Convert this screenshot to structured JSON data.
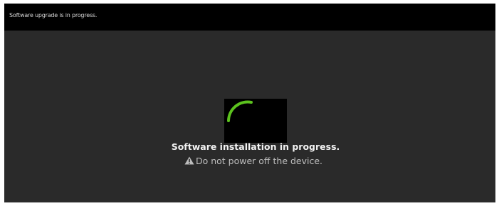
{
  "header": {
    "title": "Software upgrade is in progress."
  },
  "spinner": {
    "icon": "loading-spinner-icon",
    "color": "#5cc21e"
  },
  "status": {
    "message": "Software installation in progress.",
    "warning_icon": "warning-triangle-icon",
    "warning": "Do not power off the device."
  },
  "colors": {
    "background": "#2a2a2a",
    "header_background": "#000000",
    "accent": "#5cc21e"
  }
}
